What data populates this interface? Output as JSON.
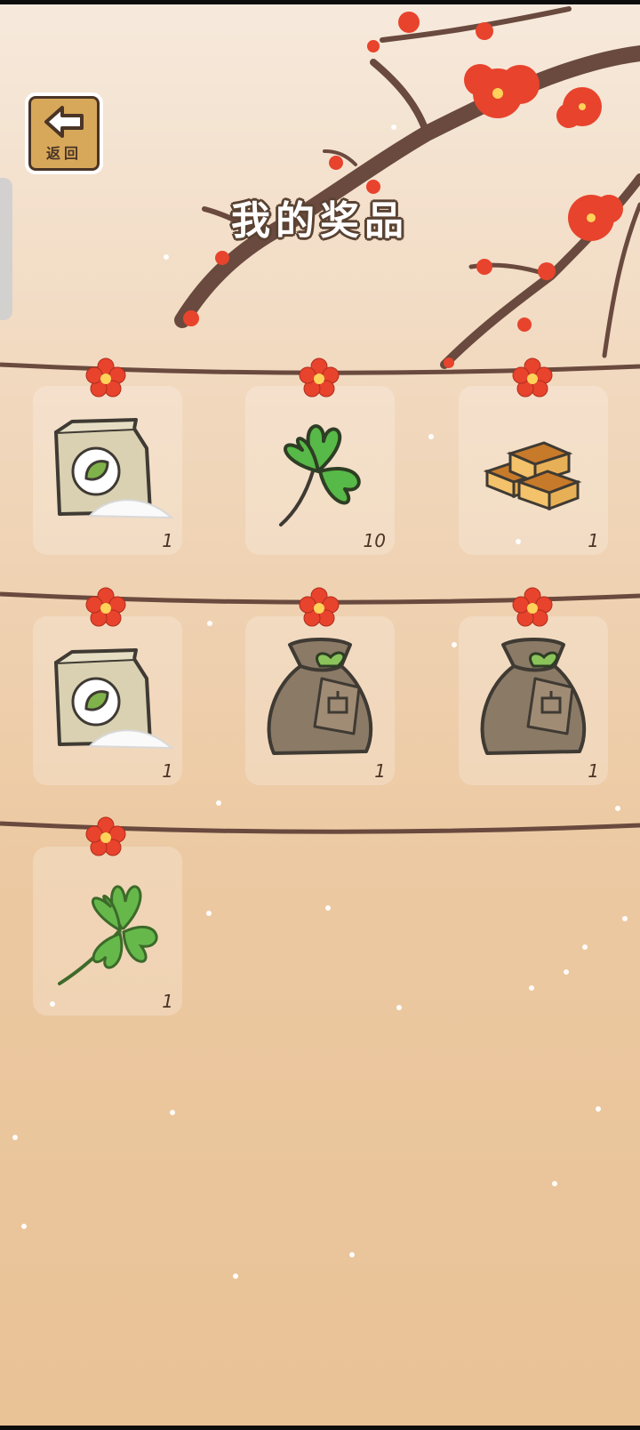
{
  "header": {
    "back_label": "返回",
    "title": "我的奖品"
  },
  "items": [
    {
      "name": "flour",
      "icon": "flour-bag-icon",
      "count": "1"
    },
    {
      "name": "clover",
      "icon": "three-leaf-clover-icon",
      "count": "10"
    },
    {
      "name": "castella",
      "icon": "castella-cake-icon",
      "count": "1"
    },
    {
      "name": "flour",
      "icon": "flour-bag-icon",
      "count": "1"
    },
    {
      "name": "seed-bag",
      "icon": "seed-bag-icon",
      "count": "1"
    },
    {
      "name": "seed-bag",
      "icon": "seed-bag-icon",
      "count": "1"
    },
    {
      "name": "lucky-clover",
      "icon": "four-leaf-clover-icon",
      "count": "1"
    }
  ],
  "colors": {
    "accent_red": "#e8432c",
    "wood": "#d8a85a",
    "outline": "#4a3426"
  }
}
